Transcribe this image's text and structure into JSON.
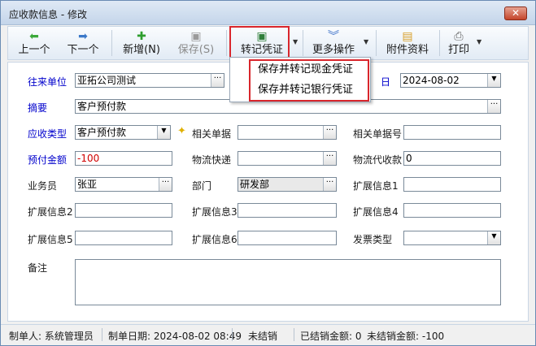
{
  "window": {
    "title": "应收款信息 - 修改",
    "close_label": "✕"
  },
  "toolbar": {
    "prev": {
      "label": "上一个",
      "icon": "left-arrow-icon"
    },
    "next": {
      "label": "下一个",
      "icon": "right-arrow-icon"
    },
    "add": {
      "label": "新增(N)",
      "icon": "plus-circle-icon"
    },
    "save": {
      "label": "保存(S)",
      "icon": "save-disk-icon"
    },
    "voucher": {
      "label": "转记凭证",
      "icon": "voucher-disk-icon"
    },
    "more": {
      "label": "更多操作",
      "icon": "double-chevron-down-icon"
    },
    "attach": {
      "label": "附件资料",
      "icon": "folder-icon"
    },
    "print": {
      "label": "打印",
      "icon": "printer-icon"
    }
  },
  "voucher_menu": {
    "items": [
      "保存并转记现金凭证",
      "保存并转记银行凭证"
    ]
  },
  "form": {
    "customer": {
      "label": "往来单位",
      "value": "亚拓公司测试"
    },
    "date": {
      "label_partial": "日",
      "value": "2024-08-02"
    },
    "summary": {
      "label": "摘要",
      "value": "客户预付款"
    },
    "receivable_type": {
      "label": "应收类型",
      "value": "客户预付款"
    },
    "related_doc": {
      "label": "相关单据",
      "value": ""
    },
    "related_doc_no": {
      "label": "相关单据号",
      "value": ""
    },
    "prepaid_amount": {
      "label": "预付金额",
      "value": "-100"
    },
    "logistics": {
      "label": "物流快递",
      "value": ""
    },
    "cod_amount": {
      "label": "物流代收款",
      "value": "0"
    },
    "salesman": {
      "label": "业务员",
      "value": "张亚"
    },
    "department": {
      "label": "部门",
      "value": "研发部"
    },
    "ext1": {
      "label": "扩展信息1",
      "value": ""
    },
    "ext2": {
      "label": "扩展信息2",
      "value": ""
    },
    "ext3": {
      "label": "扩展信息3",
      "value": ""
    },
    "ext4": {
      "label": "扩展信息4",
      "value": ""
    },
    "ext5": {
      "label": "扩展信息5",
      "value": ""
    },
    "ext6": {
      "label": "扩展信息6",
      "value": ""
    },
    "invoice_type": {
      "label": "发票类型",
      "value": ""
    },
    "remark": {
      "label": "备注",
      "value": ""
    },
    "ellipsis": "···",
    "dropdown_arrow": "▼"
  },
  "status": {
    "creator": "制单人: 系统管理员",
    "created_at": "制单日期: 2024-08-02 08:49",
    "settle_state": "未结销",
    "settled_amount": "已结销金额: 0",
    "unsettled_amount": "未结销金额: -100"
  },
  "colors": {
    "highlight": "#d9262c",
    "required_label": "#0000cc",
    "negative_value": "#d00000"
  }
}
